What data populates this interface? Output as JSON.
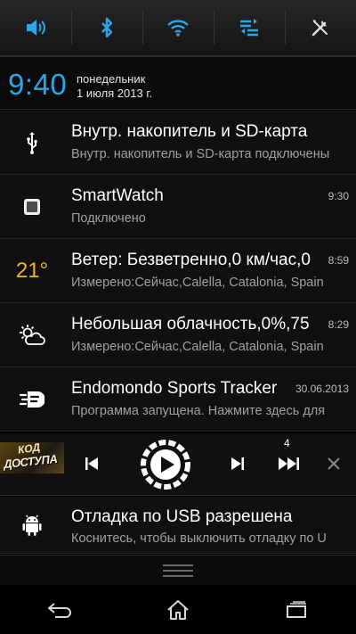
{
  "quick_settings": {
    "items": [
      {
        "name": "sound",
        "icon": "speaker-icon"
      },
      {
        "name": "bluetooth",
        "icon": "bluetooth-icon"
      },
      {
        "name": "wifi",
        "icon": "wifi-icon"
      },
      {
        "name": "data-sync",
        "icon": "sync-icon"
      },
      {
        "name": "settings",
        "icon": "wrench-screwdriver-icon"
      }
    ],
    "accent_color": "#2aa7e8"
  },
  "header": {
    "time": "9:40",
    "weekday": "понедельник",
    "date": "1 июля 2013 г."
  },
  "notifications": [
    {
      "icon": "usb-icon",
      "title": "Внутр. накопитель и SD-карта",
      "text": "Внутр. накопитель и SD-карта подключены",
      "time": ""
    },
    {
      "icon": "smartwatch-icon",
      "title": "SmartWatch",
      "text": "Подключено",
      "time": "9:30"
    },
    {
      "icon": "temperature-icon",
      "temp": "21°",
      "title": "Ветер: Безветренно,0 км/час,0",
      "text": "Измерено:Сейчас,Calella, Catalonia, Spain",
      "time": "8:59"
    },
    {
      "icon": "partly-cloudy-icon",
      "title": "Небольшая облачность,0%,75",
      "text": "Измерено:Сейчас,Calella, Catalonia, Spain",
      "time": "8:29"
    },
    {
      "icon": "endomondo-icon",
      "title": "Endomondo Sports Tracker",
      "text": "Программа запущена. Нажмите здесь для",
      "time": "30.06.2013"
    }
  ],
  "player": {
    "album_text_top": "КОД",
    "album_text_bottom": "ДОСТУПА",
    "track_number": "4"
  },
  "usb_debug": {
    "icon": "android-icon",
    "title": "Отладка по USB разрешена",
    "text": "Коснитесь, чтобы выключить отладку по U"
  },
  "navigation": {
    "items": [
      "back",
      "home",
      "recent-apps"
    ]
  }
}
